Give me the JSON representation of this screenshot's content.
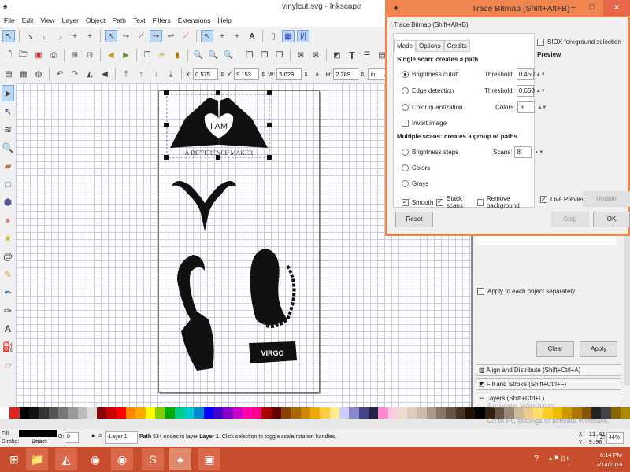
{
  "window": {
    "title": "vinylcut.svg - Inkscape"
  },
  "menu": [
    "File",
    "Edit",
    "View",
    "Layer",
    "Object",
    "Path",
    "Text",
    "Filters",
    "Extensions",
    "Help"
  ],
  "toolbar3": {
    "x_label": "X:",
    "x": "0.575",
    "y_label": "Y:",
    "y": "9.153",
    "w_label": "W:",
    "w": "5.029",
    "h_label": "H:",
    "h": "2.289",
    "unit": "in"
  },
  "artwork": {
    "heart_text1": "I AM",
    "heart_text2": "A DIFFERENCE MAKER",
    "banner_text": "VIRGO"
  },
  "dialog": {
    "title": "Trace Bitmap (Shift+Alt+B)",
    "panel_title": "Trace Bitmap (Shift+Alt+B)",
    "tabs": [
      "Mode",
      "Options",
      "Credits"
    ],
    "single_heading": "Single scan: creates a path",
    "brightness": "Brightness cutoff",
    "threshold_label": "Threshold:",
    "brightness_threshold": "0.450",
    "edge": "Edge detection",
    "edge_threshold": "0.650",
    "color_quant": "Color quantization",
    "colors_label": "Colors:",
    "colors": "8",
    "invert": "Invert image",
    "multi_heading": "Multiple scans: creates a group of paths",
    "bsteps": "Brightness steps",
    "scans_label": "Scans:",
    "scans": "8",
    "colors_opt": "Colors",
    "grays": "Grays",
    "smooth": "Smooth",
    "stack": "Stack scans",
    "remove_bg": "Remove background",
    "siox": "SIOX foreground selection",
    "preview": "Preview",
    "live_preview": "Live Preview",
    "update": "Update",
    "reset": "Reset",
    "stop": "Stop",
    "ok": "OK"
  },
  "panel": {
    "apply_each": "Apply to each object separately",
    "clear": "Clear",
    "apply": "Apply",
    "docks": [
      "Align and Distribute (Shift+Ctrl+A)",
      "Fill and Stroke (Shift+Ctrl+F)",
      "Layers (Shift+Ctrl+L)"
    ]
  },
  "watermark": {
    "line1": "Activate Windows",
    "line2": "Go to PC settings to activate Windows."
  },
  "status": {
    "fill_label": "Fill:",
    "stroke_label": "Stroke:",
    "stroke": "Unset",
    "fill_color": "#000000",
    "opacity_label": "O:",
    "opacity": "0",
    "layer": "-Layer 1",
    "msg_bold": "Path",
    "msg1": " 534 nodes in layer ",
    "msg_layer": "Layer 1",
    "msg2": ". Click selection to toggle scale/rotation handles.",
    "x_label": "X:",
    "x": "11.41",
    "y_label": "Y:",
    "y": "9.96",
    "zoom_label": "Z:",
    "zoom": "44%"
  },
  "taskbar": {
    "time": "6:14 PM",
    "date": "2/14/2018",
    "color": "#c84d2c"
  },
  "colors": {
    "dialog_border": "#f08550",
    "grid": "#c9c9ee"
  }
}
